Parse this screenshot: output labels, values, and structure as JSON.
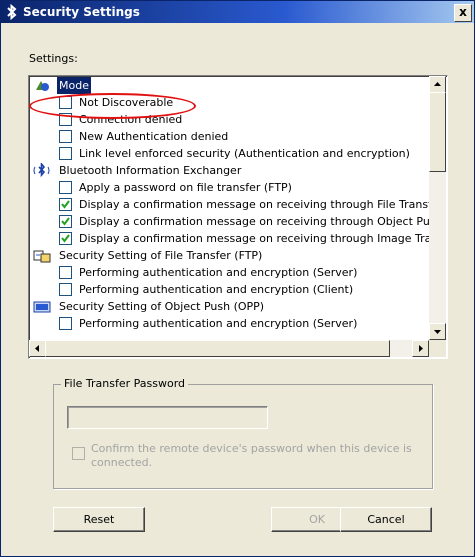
{
  "window": {
    "title": "Security Settings",
    "close_glyph": "x"
  },
  "settings_label": "Settings:",
  "tree": {
    "groups": [
      {
        "label": "Mode",
        "icon": "mode-icon",
        "selected": true,
        "items": [
          {
            "label": "Not Discoverable",
            "checked": false
          },
          {
            "label": "Connection denied",
            "checked": false
          },
          {
            "label": "New Authentication denied",
            "checked": false
          },
          {
            "label": "Link level enforced security (Authentication and encryption)",
            "checked": false
          }
        ]
      },
      {
        "label": "Bluetooth Information Exchanger",
        "icon": "bluetooth-exchanger-icon",
        "selected": false,
        "items": [
          {
            "label": "Apply a password on file transfer (FTP)",
            "checked": false
          },
          {
            "label": "Display a confirmation message on receiving through File Transfer (F",
            "checked": true
          },
          {
            "label": "Display a confirmation message on receiving through Object Push (C",
            "checked": true
          },
          {
            "label": "Display a confirmation message on receiving through Image Transfe",
            "checked": true
          }
        ]
      },
      {
        "label": "Security Setting of File Transfer (FTP)",
        "icon": "file-transfer-icon",
        "selected": false,
        "items": [
          {
            "label": "Performing authentication and encryption (Server)",
            "checked": false
          },
          {
            "label": "Performing authentication and encryption (Client)",
            "checked": false
          }
        ]
      },
      {
        "label": "Security Setting of Object Push (OPP)",
        "icon": "object-push-icon",
        "selected": false,
        "items": [
          {
            "label": "Performing authentication and encryption (Server)",
            "checked": false
          }
        ]
      }
    ]
  },
  "file_transfer_password": {
    "group_label": "File Transfer Password",
    "password_value": "",
    "confirm_label": "Confirm the remote device's password when this device is connected.",
    "confirm_checked": false
  },
  "buttons": {
    "reset": "Reset",
    "ok": "OK",
    "cancel": "Cancel"
  },
  "colors": {
    "highlight_oval": "#e01010",
    "selection": "#0a246a",
    "title_bar": "#0a246a"
  }
}
